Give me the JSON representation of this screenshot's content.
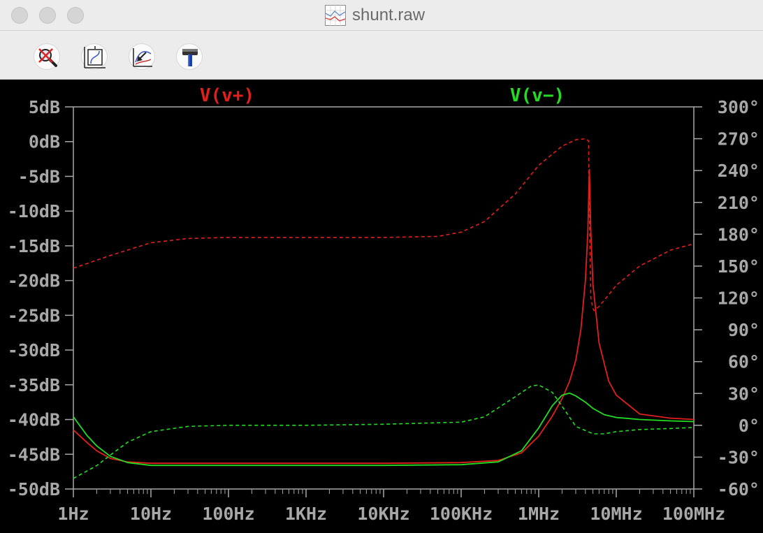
{
  "window": {
    "title": "shunt.raw"
  },
  "toolbar": {
    "buttons": [
      {
        "icon": "zoom-cancel-icon"
      },
      {
        "icon": "autorange-icon"
      },
      {
        "icon": "zoom-back-icon"
      },
      {
        "icon": "hammer-icon"
      }
    ]
  },
  "colors": {
    "red_trace": "#e0201c",
    "green_trace": "#22dd22",
    "axis": "#a8a8a8",
    "background": "#000000"
  },
  "chart_data": {
    "type": "line",
    "xscale": "log",
    "xlim": [
      1,
      100000000
    ],
    "x_tick_values": [
      1,
      10,
      100,
      1000,
      10000,
      100000,
      1000000,
      10000000,
      100000000
    ],
    "x_tick_labels": [
      "1Hz",
      "10Hz",
      "100Hz",
      "1KHz",
      "10KHz",
      "100KHz",
      "1MHz",
      "10MHz",
      "100MHz"
    ],
    "y_left": {
      "lim": [
        -50,
        5
      ],
      "tick_values": [
        5,
        0,
        -5,
        -10,
        -15,
        -20,
        -25,
        -30,
        -35,
        -40,
        -45,
        -50
      ],
      "tick_labels": [
        "5dB",
        "0dB",
        "-5dB",
        "-10dB",
        "-15dB",
        "-20dB",
        "-25dB",
        "-30dB",
        "-35dB",
        "-40dB",
        "-45dB",
        "-50dB"
      ]
    },
    "y_right": {
      "lim": [
        -60,
        300
      ],
      "tick_values": [
        300,
        270,
        240,
        210,
        180,
        150,
        120,
        90,
        60,
        30,
        0,
        -30,
        -60
      ],
      "tick_labels": [
        "300°",
        "270°",
        "240°",
        "210°",
        "180°",
        "150°",
        "120°",
        "90°",
        "60°",
        "30°",
        "0°",
        "-30°",
        "-60°"
      ]
    },
    "legend": [
      "V(v+)",
      "V(v−)"
    ],
    "series": [
      {
        "name": "V(v+)",
        "color": "#e0201c",
        "magnitude_db": {
          "x": [
            1,
            1.5,
            2,
            3,
            5,
            10,
            100,
            1000,
            10000,
            100000,
            300000,
            600000,
            1000000,
            1500000,
            2000000,
            2500000,
            3000000,
            3500000,
            4000000,
            4300000,
            4500000,
            4700000,
            5000000,
            6000000,
            8000000,
            10000000,
            20000000,
            50000000,
            100000000
          ],
          "y": [
            -41.5,
            -43.3,
            -44.5,
            -45.6,
            -46.1,
            -46.3,
            -46.3,
            -46.3,
            -46.3,
            -46.2,
            -45.9,
            -44.8,
            -42.4,
            -39.5,
            -37,
            -34.5,
            -31.5,
            -27,
            -20,
            -13,
            -4,
            -13,
            -20.5,
            -29,
            -34.5,
            -36.5,
            -39.2,
            -39.8,
            -40
          ]
        },
        "phase_deg": {
          "x": [
            1,
            3,
            10,
            30,
            100,
            1000,
            10000,
            50000,
            100000,
            200000,
            500000,
            1000000,
            2000000,
            3000000,
            4000000,
            4400000,
            4500000,
            4700000,
            5000000,
            5200000,
            6000000,
            8000000,
            10000000,
            20000000,
            50000000,
            100000000
          ],
          "y": [
            148,
            160,
            172,
            176,
            177,
            177,
            177,
            178,
            182,
            192,
            218,
            245,
            263,
            269,
            270,
            268,
            200,
            120,
            110,
            108,
            112,
            123,
            132,
            150,
            165,
            171
          ]
        }
      },
      {
        "name": "V(v−)",
        "color": "#22dd22",
        "magnitude_db": {
          "x": [
            1,
            1.5,
            2,
            3,
            5,
            10,
            100,
            1000,
            10000,
            100000,
            300000,
            600000,
            1000000,
            1500000,
            2000000,
            2500000,
            3000000,
            4000000,
            5000000,
            7000000,
            10000000,
            20000000,
            50000000,
            100000000
          ],
          "y": [
            -39.6,
            -42.3,
            -43.8,
            -45.3,
            -46.2,
            -46.6,
            -46.6,
            -46.6,
            -46.6,
            -46.5,
            -46.1,
            -44.5,
            -41.2,
            -38,
            -36.5,
            -36.2,
            -36.6,
            -37.5,
            -38.4,
            -39.3,
            -39.7,
            -40,
            -40.2,
            -40.3
          ]
        },
        "phase_deg": {
          "x": [
            1,
            2,
            3,
            5,
            10,
            30,
            100,
            1000,
            10000,
            100000,
            200000,
            500000,
            800000,
            1000000,
            1500000,
            2000000,
            3000000,
            5000000,
            7000000,
            10000000,
            20000000,
            50000000,
            100000000
          ],
          "y": [
            -50,
            -38,
            -28,
            -16,
            -6,
            -1,
            0,
            0,
            1,
            3,
            8,
            27,
            37,
            38,
            31,
            18,
            -1,
            -8,
            -8,
            -6,
            -4,
            -3,
            -2
          ]
        }
      }
    ]
  }
}
